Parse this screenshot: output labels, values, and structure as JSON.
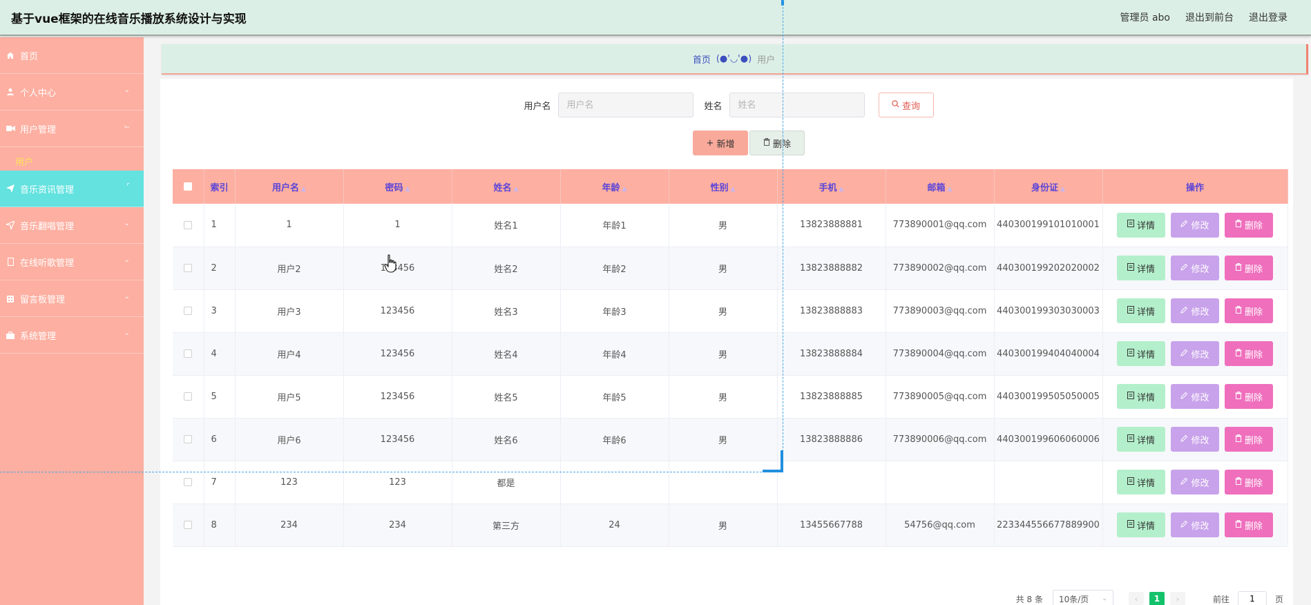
{
  "header": {
    "title": "基于vue框架的在线音乐播放系统设计与实现",
    "user": "管理员 abo",
    "to_front": "退出到前台",
    "logout": "退出登录"
  },
  "sidebar": {
    "items": [
      {
        "label": "首页",
        "icon": "home-icon"
      },
      {
        "label": "个人中心",
        "icon": "user-icon"
      },
      {
        "label": "用户管理",
        "icon": "video-icon"
      },
      {
        "label": "音乐资讯管理",
        "icon": "send-icon"
      },
      {
        "label": "音乐翻唱管理",
        "icon": "location-icon"
      },
      {
        "label": "在线听歌管理",
        "icon": "mobile-icon"
      },
      {
        "label": "留言板管理",
        "icon": "building-icon"
      },
      {
        "label": "系统管理",
        "icon": "briefcase-icon"
      }
    ],
    "submenu_user": "用户"
  },
  "breadcrumb": {
    "home": "首页",
    "separator": "(●'◡'●)",
    "current": "用户"
  },
  "search": {
    "username_label": "用户名",
    "username_placeholder": "用户名",
    "name_label": "姓名",
    "name_placeholder": "姓名",
    "query_button": "查询"
  },
  "actions": {
    "add": "新增",
    "delete": "删除"
  },
  "table": {
    "columns": [
      "索引",
      "用户名",
      "密码",
      "姓名",
      "年龄",
      "性别",
      "手机",
      "邮箱",
      "身份证",
      "操作"
    ],
    "op_labels": {
      "detail": "详情",
      "edit": "修改",
      "delete": "删除"
    },
    "rows": [
      {
        "idx": "1",
        "username": "1",
        "password": "1",
        "name": "姓名1",
        "age": "年龄1",
        "gender": "男",
        "phone": "13823888881",
        "email": "773890001@qq.com",
        "idcard": "440300199101010001"
      },
      {
        "idx": "2",
        "username": "用户2",
        "password": "123456",
        "name": "姓名2",
        "age": "年龄2",
        "gender": "男",
        "phone": "13823888882",
        "email": "773890002@qq.com",
        "idcard": "440300199202020002"
      },
      {
        "idx": "3",
        "username": "用户3",
        "password": "123456",
        "name": "姓名3",
        "age": "年龄3",
        "gender": "男",
        "phone": "13823888883",
        "email": "773890003@qq.com",
        "idcard": "440300199303030003"
      },
      {
        "idx": "4",
        "username": "用户4",
        "password": "123456",
        "name": "姓名4",
        "age": "年龄4",
        "gender": "男",
        "phone": "13823888884",
        "email": "773890004@qq.com",
        "idcard": "440300199404040004"
      },
      {
        "idx": "5",
        "username": "用户5",
        "password": "123456",
        "name": "姓名5",
        "age": "年龄5",
        "gender": "男",
        "phone": "13823888885",
        "email": "773890005@qq.com",
        "idcard": "440300199505050005"
      },
      {
        "idx": "6",
        "username": "用户6",
        "password": "123456",
        "name": "姓名6",
        "age": "年龄6",
        "gender": "男",
        "phone": "13823888886",
        "email": "773890006@qq.com",
        "idcard": "440300199606060006"
      },
      {
        "idx": "7",
        "username": "123",
        "password": "123",
        "name": "都是",
        "age": "",
        "gender": "",
        "phone": "",
        "email": "",
        "idcard": ""
      },
      {
        "idx": "8",
        "username": "234",
        "password": "234",
        "name": "第三方",
        "age": "24",
        "gender": "男",
        "phone": "13455667788",
        "email": "54756@qq.com",
        "idcard": "223344556677889900"
      }
    ]
  },
  "pagination": {
    "total": "共 8 条",
    "page_size": "10条/页",
    "current_page": "1",
    "goto_label": "前往",
    "goto_value": "1",
    "page_suffix": "页"
  }
}
